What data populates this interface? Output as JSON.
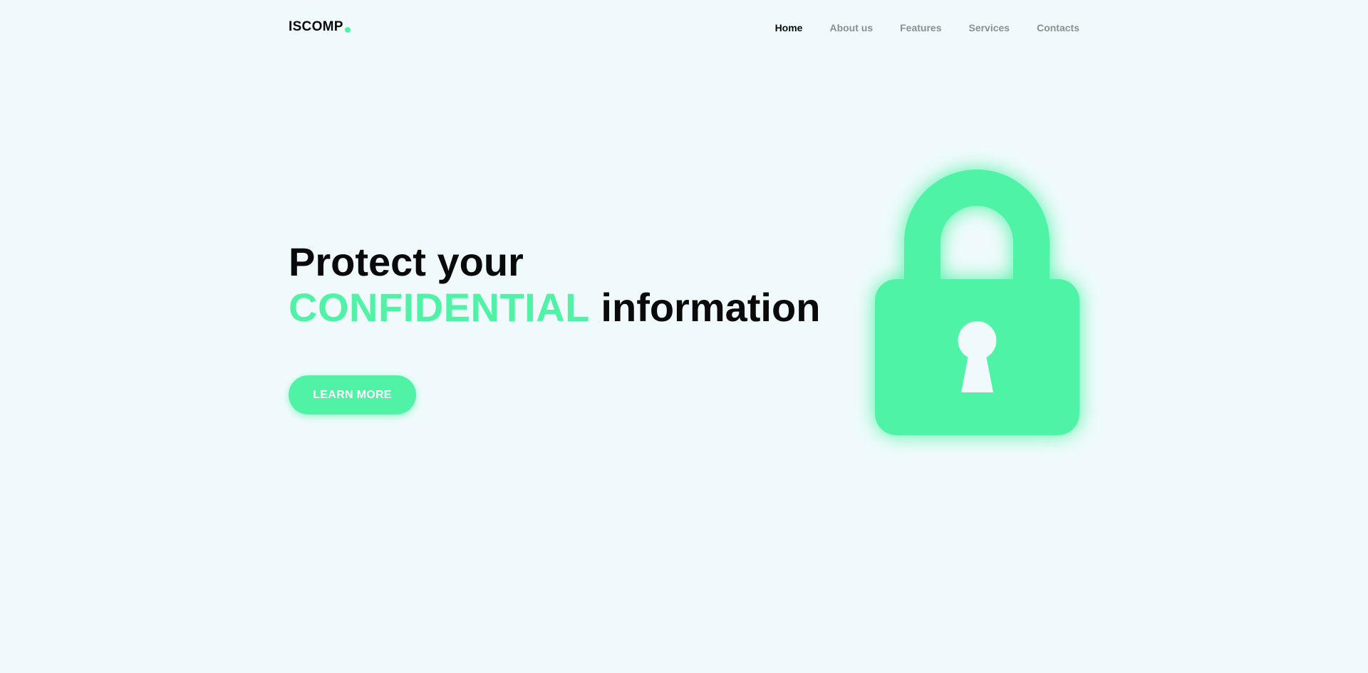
{
  "brand": {
    "name": "ISCOMP",
    "accent_color": "#50f3a5",
    "text_color": "#0a0a0a",
    "background": "#f0fafc"
  },
  "nav": {
    "items": [
      {
        "label": "Home",
        "active": true
      },
      {
        "label": "About us",
        "active": false
      },
      {
        "label": "Features",
        "active": false
      },
      {
        "label": "Services",
        "active": false
      },
      {
        "label": "Contacts",
        "active": false
      }
    ]
  },
  "hero": {
    "line1": "Protect your",
    "accent_word": "CONFIDENTIAL",
    "line2_rest": "information",
    "cta_label": "LEARN MORE"
  },
  "illustration": {
    "icon": "padlock-icon",
    "keyhole_icon": "keyhole-icon"
  }
}
